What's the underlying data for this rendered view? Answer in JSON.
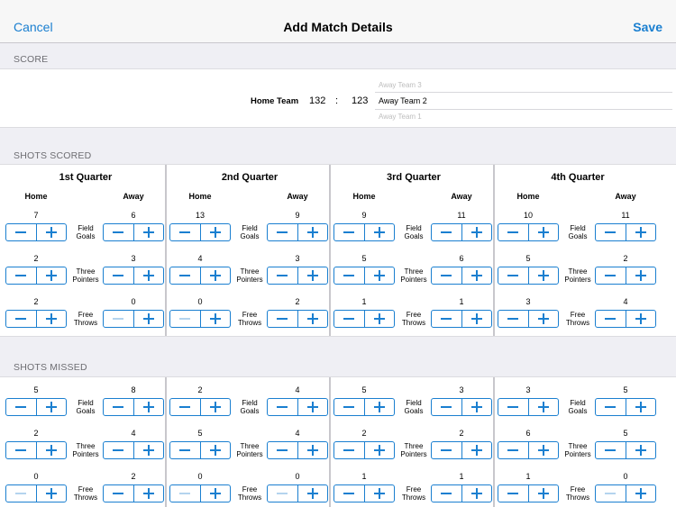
{
  "navbar": {
    "cancel_label": "Cancel",
    "title": "Add Match Details",
    "save_label": "Save"
  },
  "score": {
    "header": "SCORE",
    "home_team": "Home Team",
    "home_score": "132",
    "separator": ":",
    "away_score": "123",
    "away_team_options": [
      "Away Team 3",
      "Away Team 2",
      "Away Team 1"
    ],
    "selected_away_team": "Away Team 2"
  },
  "quarters": [
    "1st Quarter",
    "2nd Quarter",
    "3rd Quarter",
    "4th Quarter"
  ],
  "column_labels": {
    "home": "Home",
    "away": "Away"
  },
  "row_labels": [
    [
      "Field",
      "Goals"
    ],
    [
      "Three",
      "Pointers"
    ],
    [
      "Free",
      "Throws"
    ]
  ],
  "shots_scored": {
    "header": "SHOTS SCORED",
    "values": [
      [
        [
          7,
          6
        ],
        [
          2,
          3
        ],
        [
          2,
          0
        ]
      ],
      [
        [
          13,
          9
        ],
        [
          4,
          3
        ],
        [
          0,
          2
        ]
      ],
      [
        [
          9,
          11
        ],
        [
          5,
          6
        ],
        [
          1,
          1
        ]
      ],
      [
        [
          10,
          11
        ],
        [
          5,
          2
        ],
        [
          3,
          4
        ]
      ]
    ]
  },
  "shots_missed": {
    "header": "SHOTS MISSED",
    "values": [
      [
        [
          5,
          8
        ],
        [
          2,
          4
        ],
        [
          0,
          2
        ]
      ],
      [
        [
          2,
          4
        ],
        [
          5,
          4
        ],
        [
          0,
          0
        ]
      ],
      [
        [
          5,
          3
        ],
        [
          2,
          2
        ],
        [
          1,
          1
        ]
      ],
      [
        [
          3,
          5
        ],
        [
          6,
          5
        ],
        [
          1,
          0
        ]
      ]
    ]
  }
}
